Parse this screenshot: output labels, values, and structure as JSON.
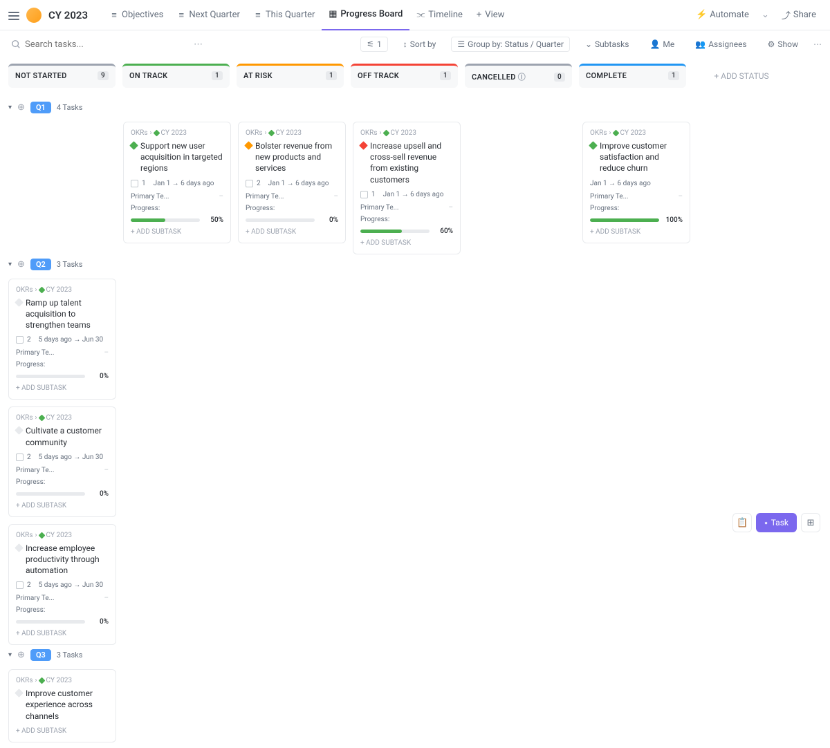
{
  "workspace": {
    "title": "CY 2023"
  },
  "tabs": [
    {
      "label": "Objectives",
      "icon": "list"
    },
    {
      "label": "Next Quarter",
      "icon": "list"
    },
    {
      "label": "This Quarter",
      "icon": "list"
    },
    {
      "label": "Progress Board",
      "icon": "board",
      "active": true
    },
    {
      "label": "Timeline",
      "icon": "timeline"
    }
  ],
  "view_btn": {
    "label": "View"
  },
  "nav_right": {
    "automate": "Automate",
    "share": "Share"
  },
  "search": {
    "placeholder": "Search tasks..."
  },
  "toolbar": {
    "filter_count": "1",
    "sort": "Sort by",
    "group": "Group by: Status / Quarter",
    "subtasks": "Subtasks",
    "me": "Me",
    "assignees": "Assignees",
    "show": "Show"
  },
  "columns": [
    {
      "name": "NOT STARTED",
      "count": "9",
      "color": "#9ca3af"
    },
    {
      "name": "ON TRACK",
      "count": "1",
      "color": "#4caf50"
    },
    {
      "name": "AT RISK",
      "count": "1",
      "color": "#ff9800"
    },
    {
      "name": "OFF TRACK",
      "count": "1",
      "color": "#f44336"
    },
    {
      "name": "CANCELLED",
      "count": "0",
      "color": "#9ca3af",
      "info": true
    },
    {
      "name": "COMPLETE",
      "count": "1",
      "color": "#2196f3"
    }
  ],
  "add_status": "+ ADD STATUS",
  "groups": [
    {
      "badge": "Q1",
      "count": "4 Tasks",
      "lanes": {
        "on_track": [
          {
            "crumb": "OKRs",
            "crumb2": "CY 2023",
            "diamond": "#4caf50",
            "title": "Support new user acquisition in targeted regions",
            "sub": "1",
            "date": "Jan 1 → 6 days ago",
            "team": "Primary Te...",
            "team_val": "–",
            "prog_label": "Progress:",
            "pct": 50,
            "pct_txt": "50%"
          }
        ],
        "at_risk": [
          {
            "crumb": "OKRs",
            "crumb2": "CY 2023",
            "diamond": "#ff9800",
            "title": "Bolster revenue from new products and services",
            "sub": "2",
            "date": "Jan 1 → 6 days ago",
            "team": "Primary Te...",
            "team_val": "–",
            "prog_label": "Progress:",
            "pct": 0,
            "pct_txt": "0%"
          }
        ],
        "off_track": [
          {
            "crumb": "OKRs",
            "crumb2": "CY 2023",
            "diamond": "#f44336",
            "title": "Increase upsell and cross-sell revenue from existing customers",
            "sub": "1",
            "date": "Jan 1 → 6 days ago",
            "team": "Primary Te...",
            "team_val": "–",
            "prog_label": "Progress:",
            "pct": 60,
            "pct_txt": "60%"
          }
        ],
        "complete": [
          {
            "crumb": "OKRs",
            "crumb2": "CY 2023",
            "diamond": "#4caf50",
            "title": "Improve customer satisfaction and reduce churn",
            "sub": "",
            "date": "Jan 1 → 6 days ago",
            "team": "Primary Te...",
            "team_val": "–",
            "prog_label": "Progress:",
            "pct": 100,
            "pct_txt": "100%"
          }
        ]
      }
    },
    {
      "badge": "Q2",
      "count": "3 Tasks",
      "lanes": {
        "not_started": [
          {
            "crumb": "OKRs",
            "crumb2": "CY 2023",
            "diamond": "#e8eaed",
            "title": "Ramp up talent acquisition to strengthen teams",
            "sub": "2",
            "date": "5 days ago → Jun 30",
            "team": "Primary Te...",
            "team_val": "–",
            "prog_label": "Progress:",
            "pct": 0,
            "pct_txt": "0%"
          },
          {
            "crumb": "OKRs",
            "crumb2": "CY 2023",
            "diamond": "#e8eaed",
            "title": "Cultivate a customer community",
            "sub": "2",
            "date": "5 days ago → Jun 30",
            "team": "Primary Te...",
            "team_val": "–",
            "prog_label": "Progress:",
            "pct": 0,
            "pct_txt": "0%"
          },
          {
            "crumb": "OKRs",
            "crumb2": "CY 2023",
            "diamond": "#e8eaed",
            "title": "Increase employee productivity through automation",
            "sub": "2",
            "date": "5 days ago → Jun 30",
            "team": "Primary Te...",
            "team_val": "–",
            "prog_label": "Progress:",
            "pct": 0,
            "pct_txt": "0%"
          }
        ]
      }
    },
    {
      "badge": "Q3",
      "count": "3 Tasks",
      "lanes": {
        "not_started": [
          {
            "crumb": "OKRs",
            "crumb2": "CY 2023",
            "diamond": "#e8eaed",
            "title": "Improve customer experience across channels",
            "sub": "",
            "date": "",
            "team": "",
            "team_val": "",
            "prog_label": "",
            "pct": 0,
            "pct_txt": ""
          }
        ]
      }
    }
  ],
  "labels": {
    "add_subtask": "+ ADD SUBTASK",
    "task": "Task"
  }
}
